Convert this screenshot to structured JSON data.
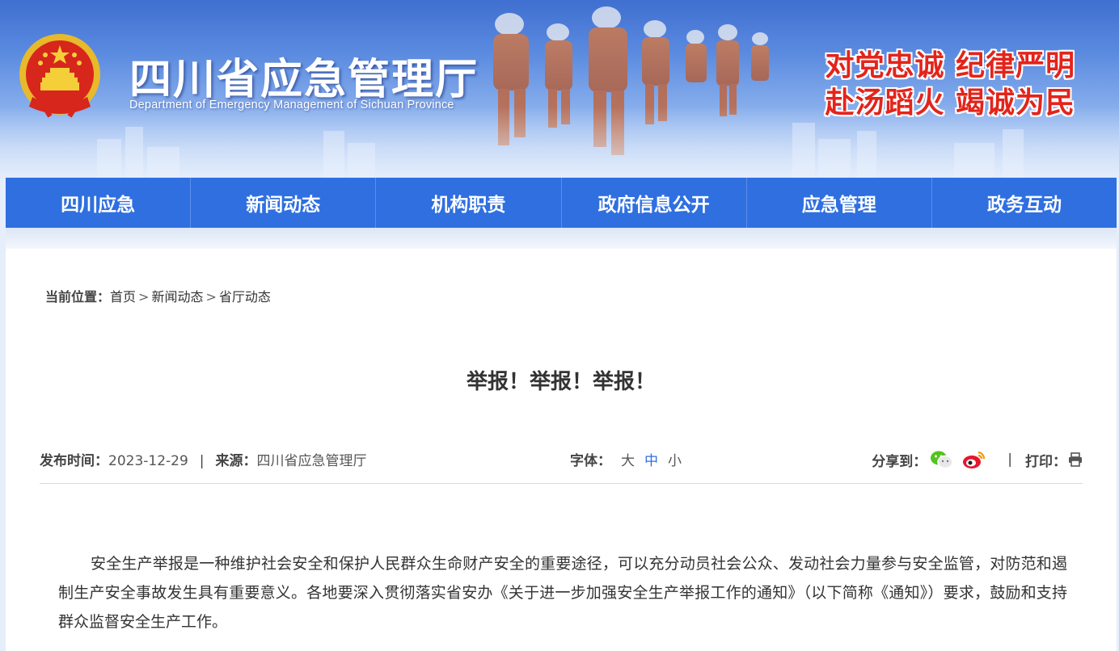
{
  "header": {
    "site_title": "四川省应急管理厅",
    "site_subtitle": "Department of Emergency Management of Sichuan Province",
    "slogan_line1": "对党忠诚 纪律严明",
    "slogan_line2": "赴汤蹈火 竭诚为民",
    "colors": {
      "banner_blue": "#3f6fd0",
      "slogan_red": "#e3241b"
    }
  },
  "nav": {
    "items": [
      "四川应急",
      "新闻动态",
      "机构职责",
      "政府信息公开",
      "应急管理",
      "政务互动"
    ],
    "color": "#2f6fe0"
  },
  "breadcrumb": {
    "label": "当前位置：",
    "items": [
      "首页",
      "新闻动态",
      "省厅动态"
    ],
    "separator": ">"
  },
  "article": {
    "title": "举报！举报！举报！",
    "publish_label": "发布时间：",
    "publish_date": "2023-12-29",
    "source_label": "来源：",
    "source": "四川省应急管理厅",
    "font_label": "字体：",
    "font_sizes": [
      "大",
      "中",
      "小"
    ],
    "font_size_selected": "中",
    "share_label": "分享到：",
    "share_icons": [
      "wechat-icon",
      "weibo-icon"
    ],
    "print_label": "打印：",
    "print_icon": "printer-icon",
    "paragraph": "安全生产举报是一种维护社会安全和保护人民群众生命财产安全的重要途径，可以充分动员社会公众、发动社会力量参与安全监管，对防范和遏制生产安全事故发生具有重要意义。各地要深入贯彻落实省安办《关于进一步加强安全生产举报工作的通知》（以下简称《通知》）要求，鼓励和支持群众监督安全生产工作。"
  }
}
